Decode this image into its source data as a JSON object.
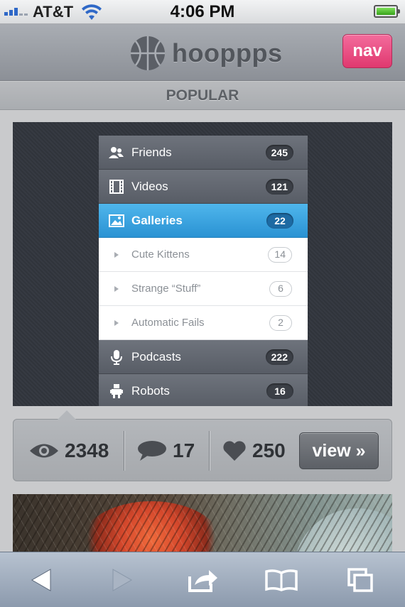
{
  "status_bar": {
    "carrier": "AT&T",
    "time": "4:06 PM",
    "signal_bars_active": 3,
    "battery_level": 1.0
  },
  "app": {
    "name": "hooppps",
    "nav_label": "nav",
    "section_title": "POPULAR",
    "accent_color": "#e8477d"
  },
  "shot_menu": {
    "items": [
      {
        "label": "Friends",
        "count": "245",
        "icon": "friends-icon",
        "state": "normal"
      },
      {
        "label": "Videos",
        "count": "121",
        "icon": "film-icon",
        "state": "normal"
      },
      {
        "label": "Galleries",
        "count": "22",
        "icon": "picture-icon",
        "state": "active"
      },
      {
        "label": "Cute Kittens",
        "count": "14",
        "state": "sub"
      },
      {
        "label": "Strange “Stuff”",
        "count": "6",
        "state": "sub"
      },
      {
        "label": "Automatic Fails",
        "count": "2",
        "state": "sub"
      },
      {
        "label": "Podcasts",
        "count": "222",
        "icon": "microphone-icon",
        "state": "normal"
      },
      {
        "label": "Robots",
        "count": "16",
        "icon": "robot-icon",
        "state": "normal"
      }
    ]
  },
  "stats": {
    "views": "2348",
    "comments": "17",
    "likes": "250",
    "view_label": "view »"
  },
  "toolbar": {
    "icons": [
      "back-icon",
      "forward-icon",
      "share-icon",
      "bookmarks-icon",
      "tabs-icon"
    ]
  }
}
